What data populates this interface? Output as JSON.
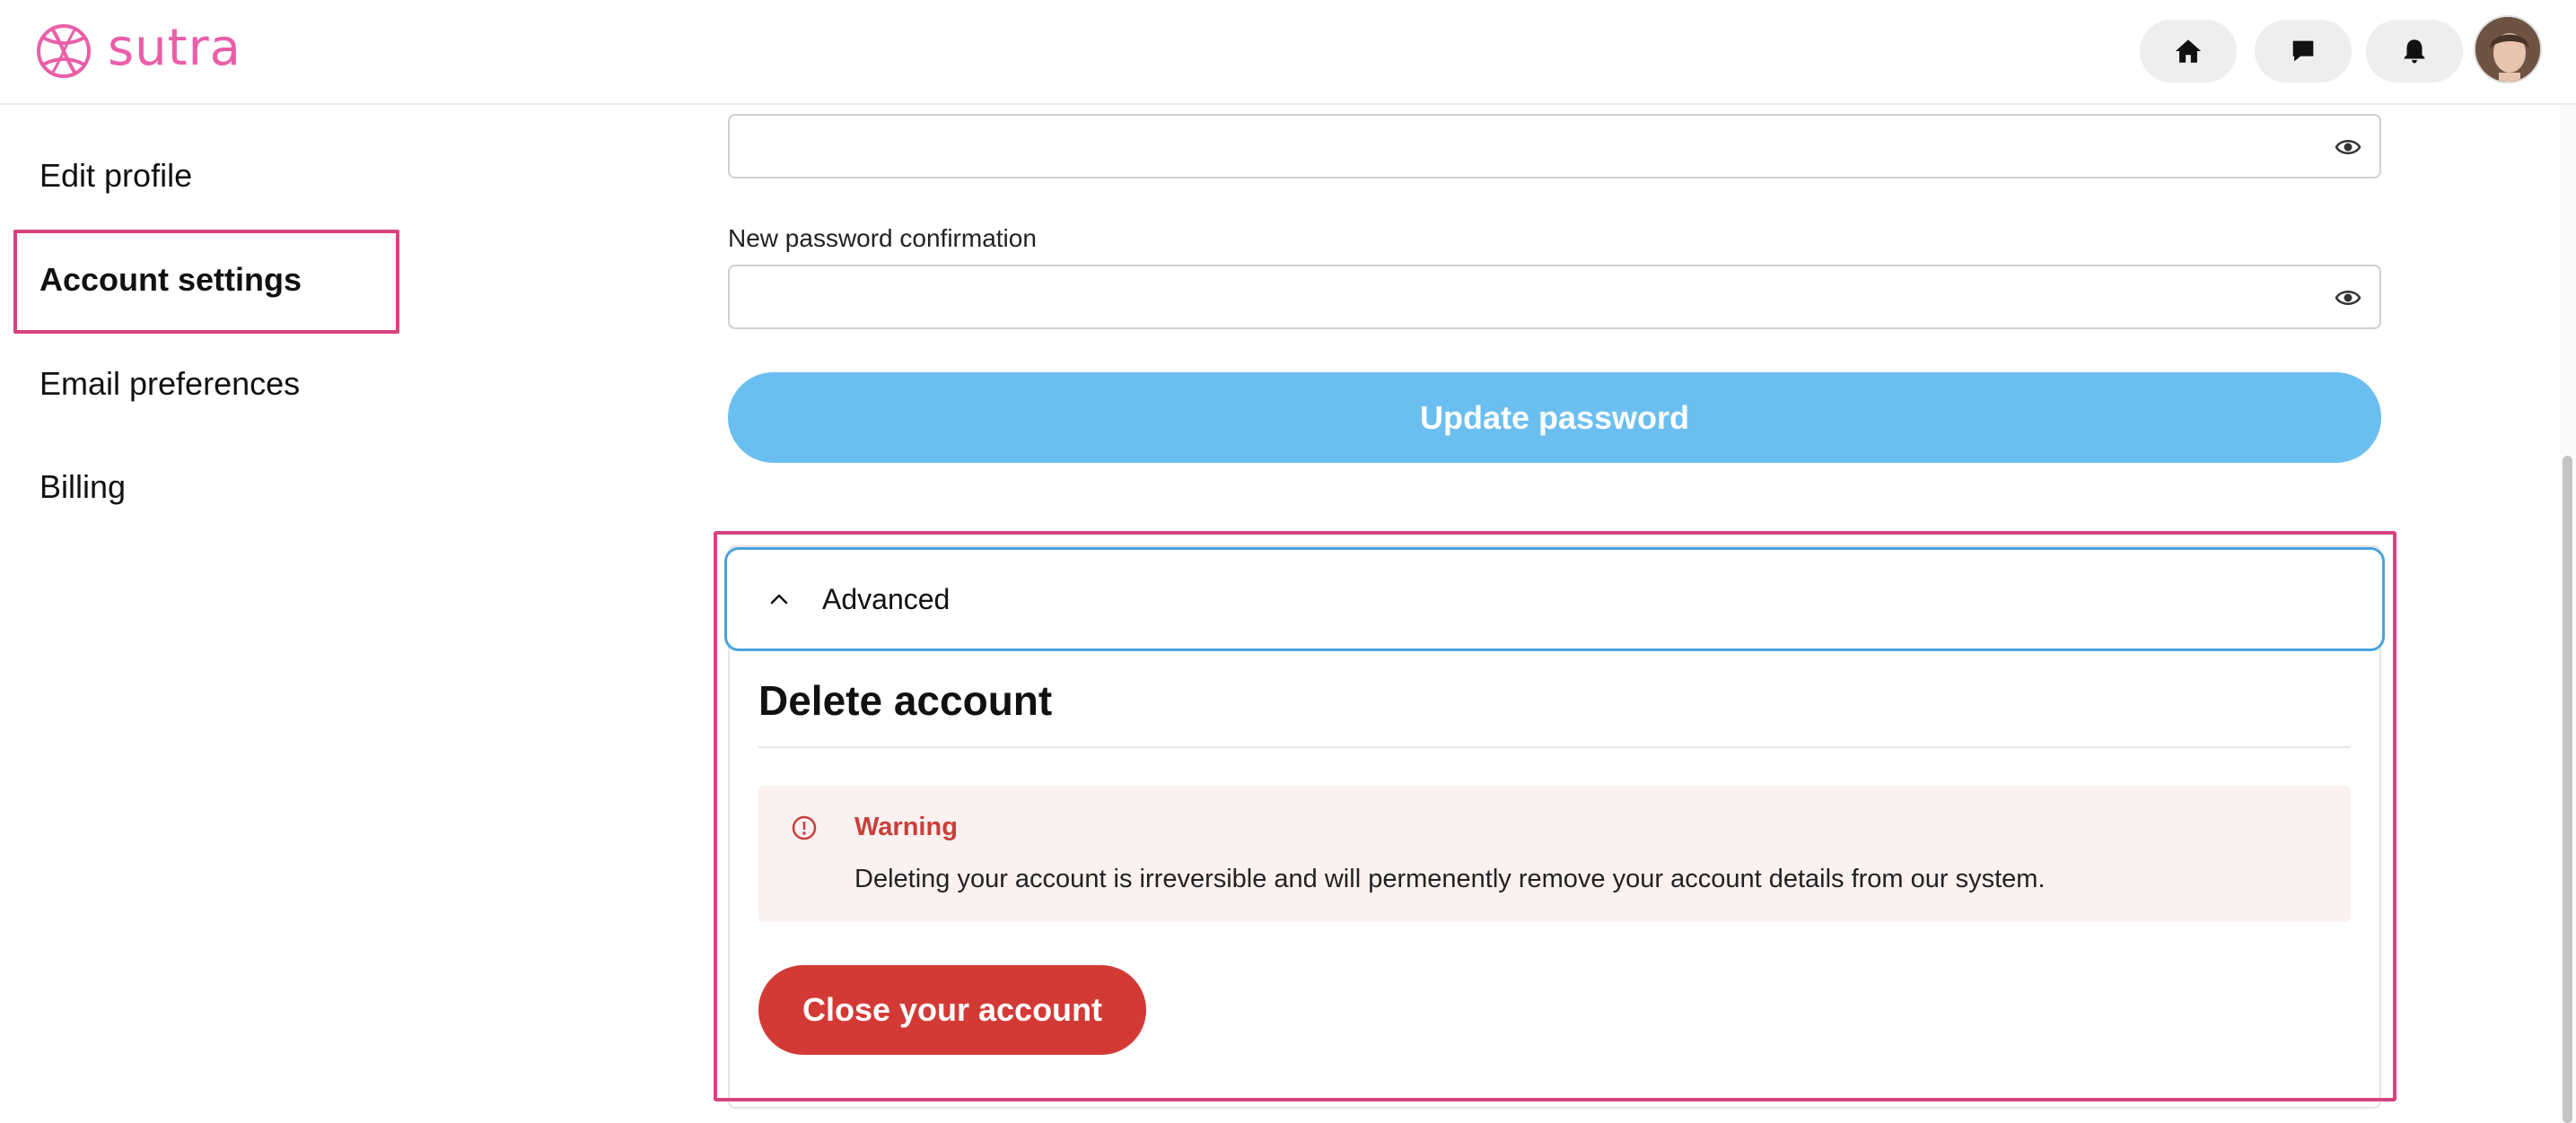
{
  "app": {
    "brand_name": "sutra",
    "brand_color": "#ea5ea9",
    "icons": [
      "sutra-logo-icon",
      "home-icon",
      "chat-icon",
      "bell-icon",
      "user-avatar"
    ]
  },
  "sidebar": {
    "items": [
      {
        "label": "Edit profile",
        "active": false
      },
      {
        "label": "Account settings",
        "active": true
      },
      {
        "label": "Email preferences",
        "active": false
      },
      {
        "label": "Billing",
        "active": false
      }
    ]
  },
  "password_form": {
    "new_password_value": "",
    "confirmation_label": "New password confirmation",
    "confirmation_value": "",
    "update_button": "Update password",
    "update_button_color": "#6bbff0"
  },
  "advanced": {
    "header_label": "Advanced",
    "expanded": true,
    "delete_title": "Delete account",
    "warning_title": "Warning",
    "warning_text": "Deleting your account is irreversible and will permenently remove your account details from our system.",
    "close_button": "Close your account",
    "danger_color": "#d33a36",
    "highlight_color": "#d9427e"
  }
}
